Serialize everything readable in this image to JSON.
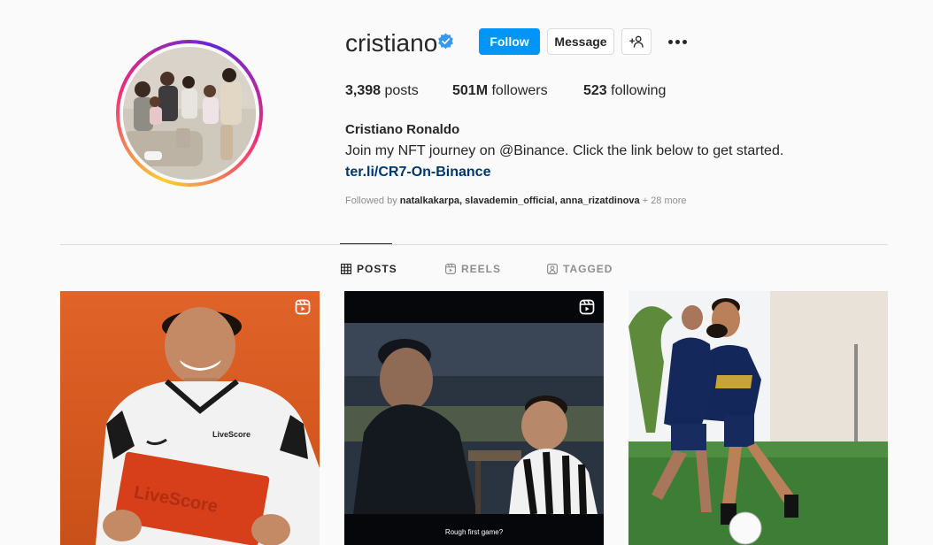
{
  "profile": {
    "username": "cristiano",
    "verified_icon": "verified-badge-icon",
    "full_name": "Cristiano Ronaldo",
    "bio": "Join my NFT journey on @Binance. Click the link below to get started.",
    "link": "ter.li/CR7-On-Binance",
    "avatar_ring_colors": [
      "#f9ce34",
      "#ee2a7b",
      "#6228d7"
    ]
  },
  "actions": {
    "follow_label": "Follow",
    "message_label": "Message",
    "suggest_icon": "add-person-icon",
    "more_icon": "more-options-icon",
    "follow_color": "#0095f6"
  },
  "stats": {
    "posts_count": "3,398",
    "posts_label": "posts",
    "followers_count": "501M",
    "followers_label": "followers",
    "following_count": "523",
    "following_label": "following"
  },
  "followed_by": {
    "prefix": "Followed by",
    "users": [
      "natalkakarpa",
      "slavademin_official",
      "anna_rizatdinova"
    ],
    "separator": ", ",
    "more": "+ 28 more"
  },
  "tabs": [
    {
      "label": "POSTS",
      "icon": "grid-icon",
      "active": true
    },
    {
      "label": "REELS",
      "icon": "reels-icon",
      "active": false
    },
    {
      "label": "TAGGED",
      "icon": "tagged-icon",
      "active": false
    }
  ],
  "posts": [
    {
      "type": "reel",
      "caption": ""
    },
    {
      "type": "reel",
      "caption": "Rough first game?"
    },
    {
      "type": "photo",
      "caption": ""
    }
  ]
}
